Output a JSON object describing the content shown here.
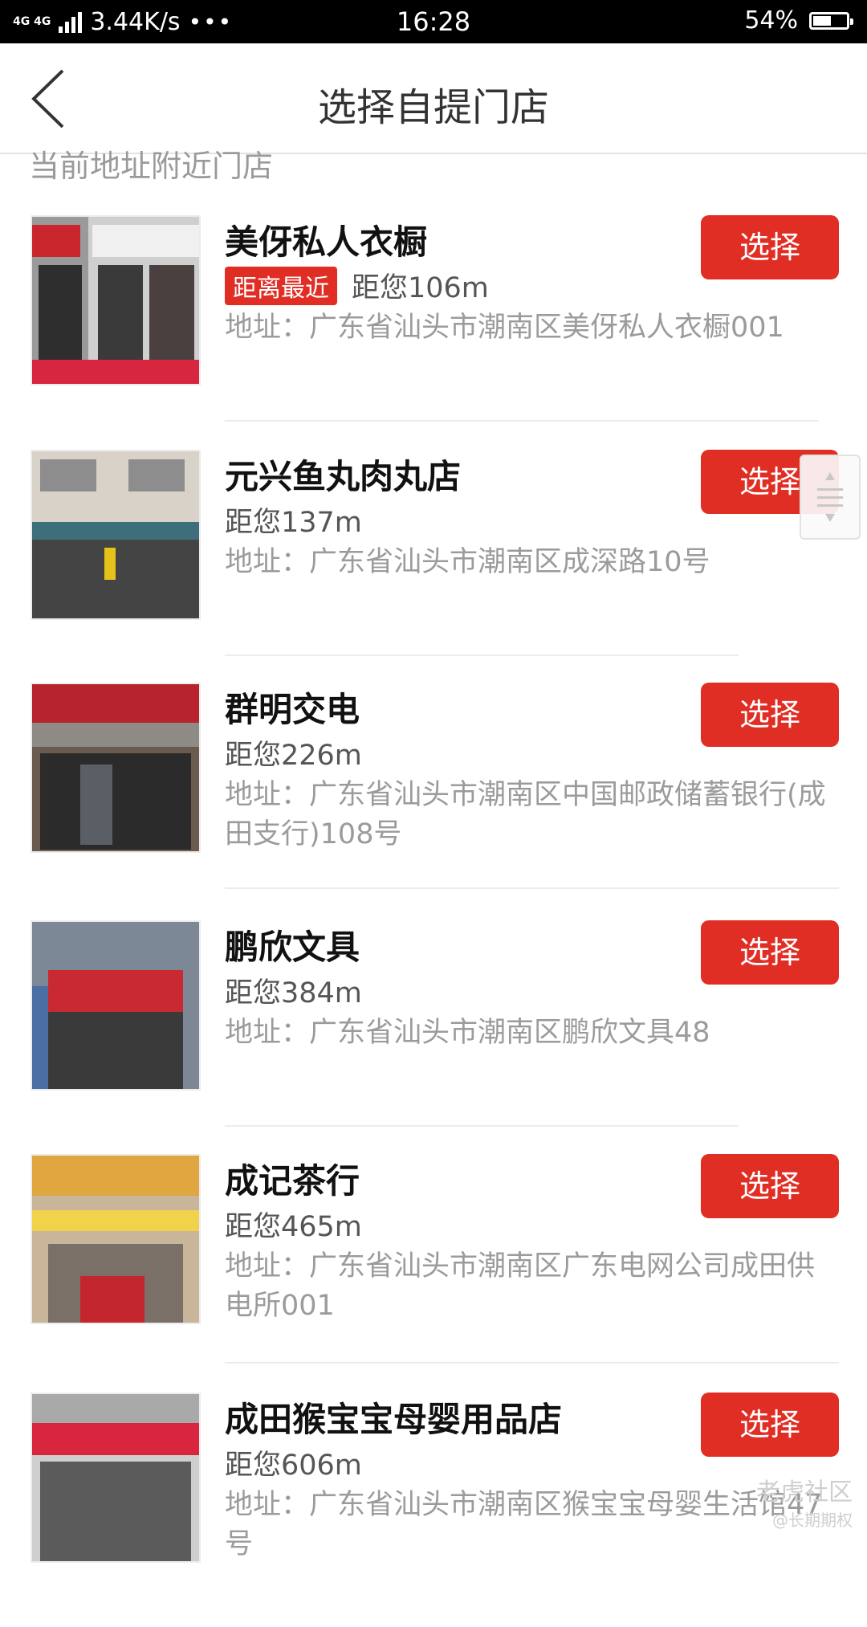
{
  "status_bar": {
    "signal": "4G 4G",
    "speed": "3.44K/s",
    "dots": "•••",
    "time": "16:28",
    "battery_percent": "54%",
    "battery_level": 0.54
  },
  "nav": {
    "title": "选择自提门店"
  },
  "section": {
    "header": "当前地址附近门店"
  },
  "stores": [
    {
      "name": "美伢私人衣橱",
      "badge": "距离最近",
      "distance": "距您106m",
      "address": "地址：广东省汕头市潮南区美伢私人衣橱001",
      "button": "选择"
    },
    {
      "name": "元兴鱼丸肉丸店",
      "distance": "距您137m",
      "address": "地址：广东省汕头市潮南区成深路10号",
      "button": "选择"
    },
    {
      "name": "群明交电",
      "distance": "距您226m",
      "address": "地址：广东省汕头市潮南区中国邮政储蓄银行(成田支行)108号",
      "button": "选择"
    },
    {
      "name": "鹏欣文具",
      "distance": "距您384m",
      "address": "地址：广东省汕头市潮南区鹏欣文具48",
      "button": "选择"
    },
    {
      "name": "成记茶行",
      "distance": "距您465m",
      "address": "地址：广东省汕头市潮南区广东电网公司成田供电所001",
      "button": "选择"
    },
    {
      "name": "成田猴宝宝母婴用品店",
      "distance": "距您606m",
      "address": "地址：广东省汕头市潮南区猴宝宝母婴生活馆47号",
      "button": "选择"
    }
  ],
  "watermark": {
    "main": "老虎社区",
    "sub": "@长期期权"
  },
  "colors": {
    "accent": "#e02e24",
    "title_text": "#333333",
    "secondary_text": "#9b9b9b"
  }
}
